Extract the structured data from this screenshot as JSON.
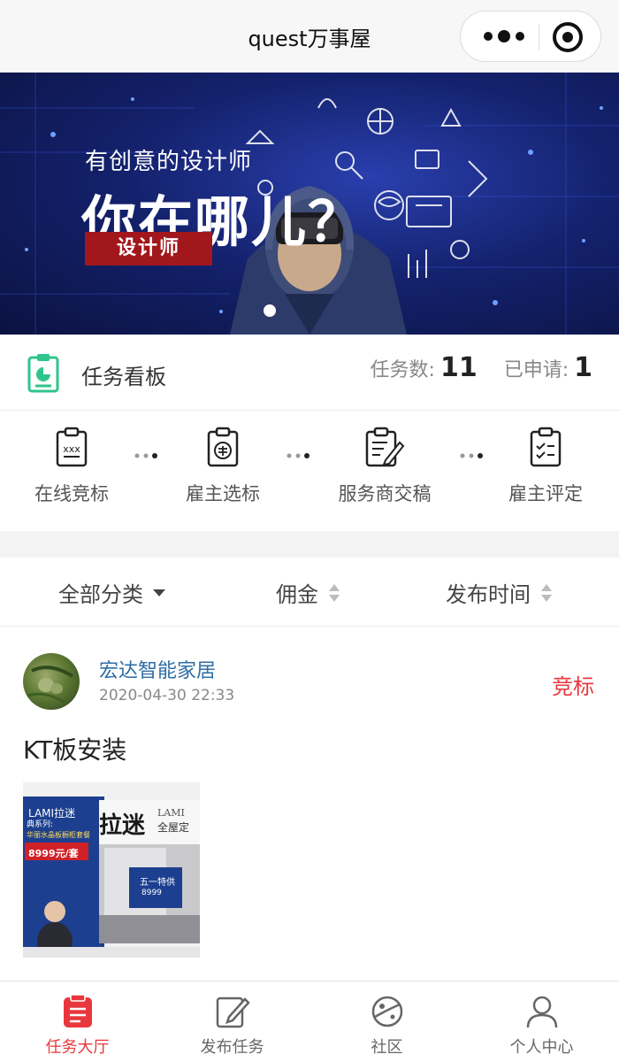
{
  "navbar": {
    "title": "quest万事屋",
    "more_icon": "more-dots-icon",
    "close_icon": "target-circle-icon"
  },
  "banner": {
    "subtitle": "有创意的设计师",
    "headline": "你在哪儿？",
    "tag": "设计师",
    "active_slide": 1,
    "colors": {
      "background": "#14226e",
      "tag": "#a1171c"
    }
  },
  "task_board": {
    "icon": "clipboard-chart-icon",
    "title": "任务看板",
    "task_count_label": "任务数:",
    "task_count": "11",
    "applied_label": "已申请:",
    "applied_count": "1"
  },
  "steps": [
    {
      "label": "在线竞标",
      "icon": "clipboard-xxx-icon"
    },
    {
      "label": "雇主选标",
      "icon": "clipboard-coin-icon"
    },
    {
      "label": "服务商交稿",
      "icon": "clipboard-pen-icon"
    },
    {
      "label": "雇主评定",
      "icon": "clipboard-check-icon"
    }
  ],
  "filters": {
    "category": "全部分类",
    "commission": "佣金",
    "publish_time": "发布时间"
  },
  "task": {
    "company": "宏达智能家居",
    "time": "2020-04-30 22:33",
    "status": "竞标",
    "title": "KT板安装",
    "image": {
      "brand_small": "LAMI拉迷",
      "brand": "拉迷",
      "brand_en": "LAMI",
      "brand_sub": "全屋定",
      "series": "典系列:",
      "series_name": "华丽水晶板橱柜套餐",
      "price": "8999元/套",
      "promo": "五一特供",
      "promo_price": "8999"
    }
  },
  "tabbar": {
    "items": [
      {
        "label": "任务大厅",
        "icon": "task-hall-icon",
        "active": true
      },
      {
        "label": "发布任务",
        "icon": "publish-edit-icon",
        "active": false
      },
      {
        "label": "社区",
        "icon": "community-planet-icon",
        "active": false
      },
      {
        "label": "个人中心",
        "icon": "user-profile-icon",
        "active": false
      }
    ],
    "colors": {
      "active": "#e8383d",
      "inactive": "#666666"
    }
  }
}
